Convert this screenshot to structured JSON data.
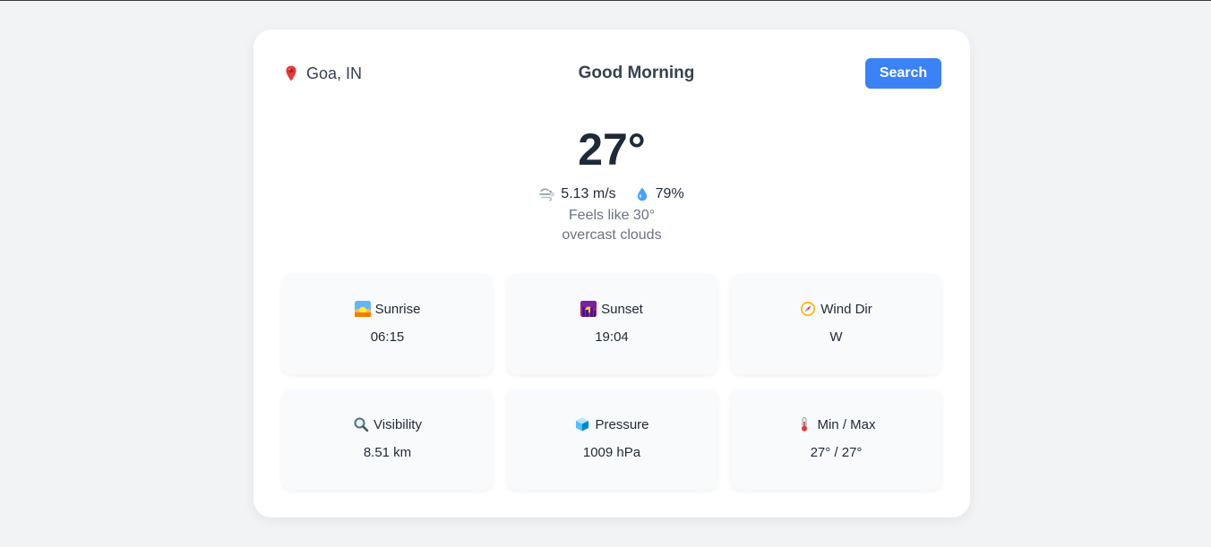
{
  "header": {
    "location": "Goa, IN",
    "greeting": "Good Morning",
    "search_label": "Search"
  },
  "current": {
    "temperature": "27°",
    "wind": "5.13 m/s",
    "humidity": "79%",
    "feels_like": "Feels like 30°",
    "description": "overcast clouds"
  },
  "details": [
    {
      "icon": "sunrise-icon",
      "label": "Sunrise",
      "value": "06:15"
    },
    {
      "icon": "sunset-icon",
      "label": "Sunset",
      "value": "19:04"
    },
    {
      "icon": "compass-icon",
      "label": "Wind Dir",
      "value": "W"
    },
    {
      "icon": "magnifier-icon",
      "label": "Visibility",
      "value": "8.51 km"
    },
    {
      "icon": "ice-cube-icon",
      "label": "Pressure",
      "value": "1009 hPa"
    },
    {
      "icon": "thermometer-icon",
      "label": "Min / Max",
      "value": "27° / 27°"
    }
  ],
  "colors": {
    "accent": "#3b82f6",
    "background": "#f2f3f5",
    "card": "#ffffff",
    "tile": "#f9fafb",
    "muted_text": "#6b7280"
  }
}
